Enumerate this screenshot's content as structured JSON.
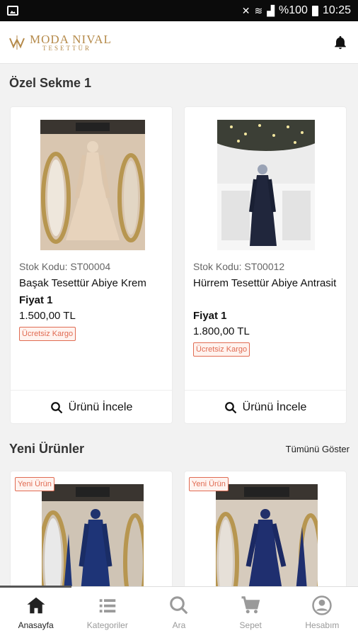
{
  "status_bar": {
    "battery": "%100",
    "time": "10:25"
  },
  "brand": {
    "line1": "MODA NIVAL",
    "line2": "TESETTÜR"
  },
  "section1": {
    "title": "Özel Sekme 1",
    "products": [
      {
        "stock": "Stok Kodu: ST00004",
        "name": "Başak Tesettür Abiye Krem",
        "price_label": "Fiyat 1",
        "price": "1.500,00 TL",
        "badge": "Ücretsiz Kargo",
        "action": "Ürünü İncele"
      },
      {
        "stock": "Stok Kodu: ST00012",
        "name": "Hürrem Tesettür Abiye Antrasit",
        "price_label": "Fiyat 1",
        "price": "1.800,00 TL",
        "badge": "Ücretsiz Kargo",
        "action": "Ürünü İncele"
      }
    ]
  },
  "section2": {
    "title": "Yeni Ürünler",
    "show_all": "Tümünü Göster",
    "products": [
      {
        "badge": "Yeni Ürün"
      },
      {
        "badge": "Yeni Ürün"
      }
    ]
  },
  "nav": {
    "items": [
      {
        "label": "Anasayfa",
        "icon": "home-icon"
      },
      {
        "label": "Kategoriler",
        "icon": "list-icon"
      },
      {
        "label": "Ara",
        "icon": "search-icon"
      },
      {
        "label": "Sepet",
        "icon": "cart-icon"
      },
      {
        "label": "Hesabım",
        "icon": "account-icon"
      }
    ],
    "active": "Anasayfa"
  },
  "colors": {
    "accent": "#e06b52",
    "brand": "#b58a4a"
  }
}
